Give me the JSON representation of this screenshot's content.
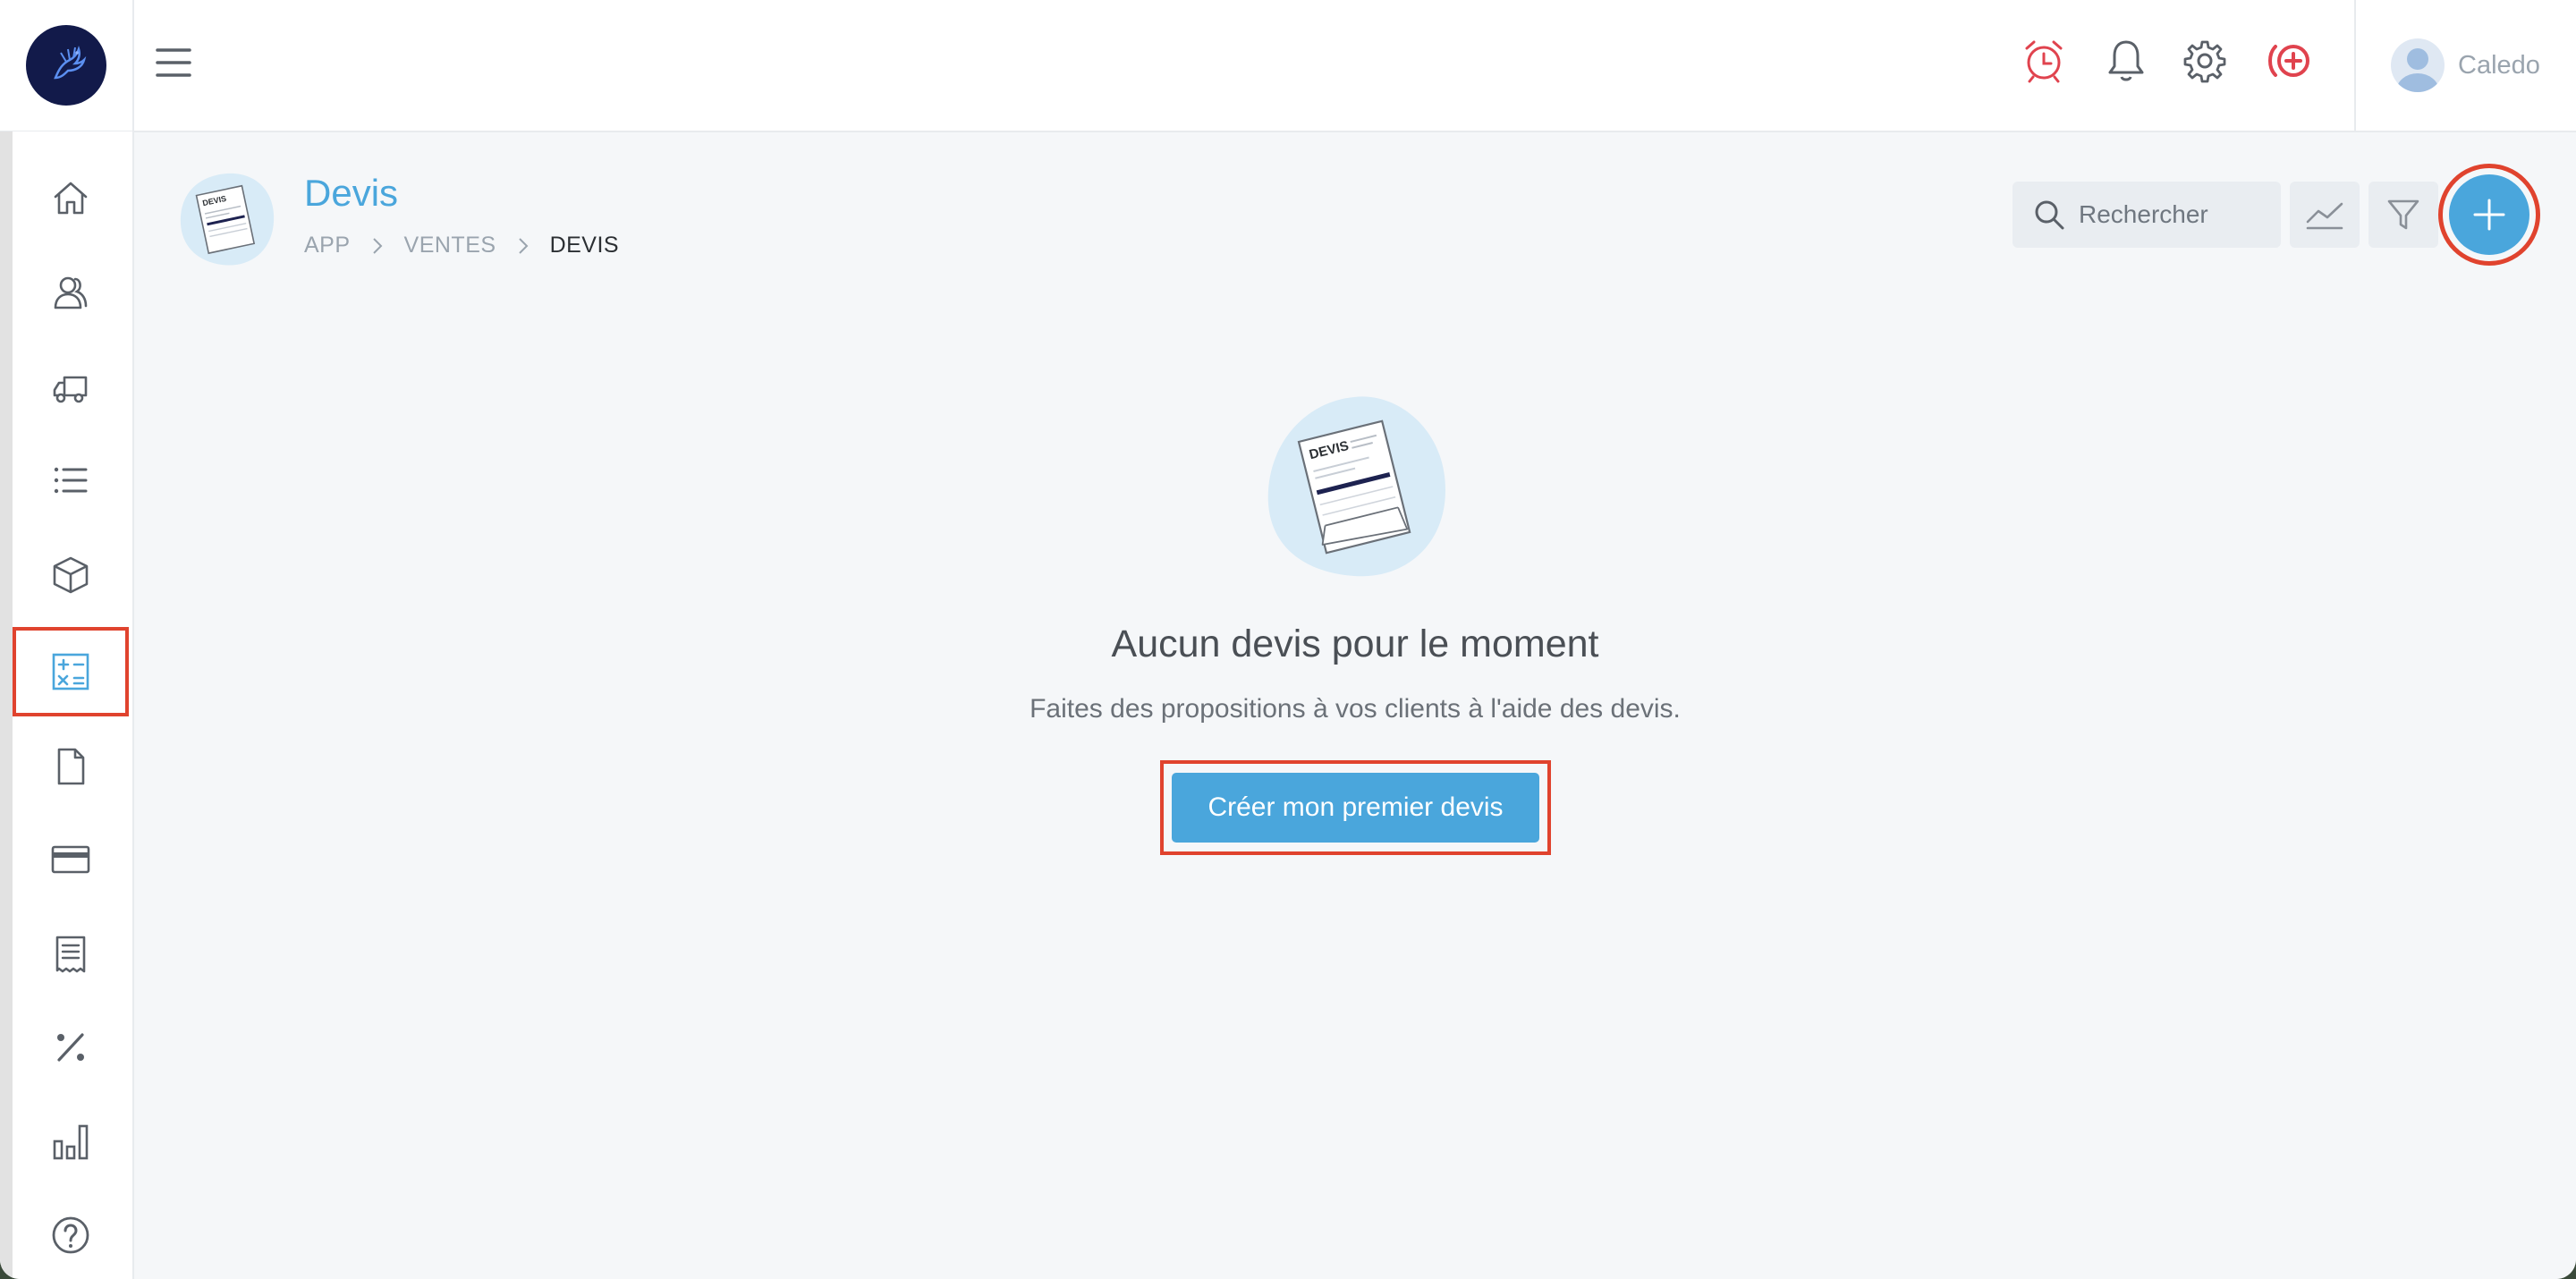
{
  "header": {
    "user_name": "Caledo",
    "icons": [
      "menu-icon",
      "alarm-clock-icon",
      "bell-icon",
      "gear-icon",
      "add-circle-icon"
    ],
    "alert_color": "#e0434e"
  },
  "sidebar": {
    "items": [
      {
        "name": "home",
        "icon": "home-icon"
      },
      {
        "name": "clients",
        "icon": "users-icon"
      },
      {
        "name": "suppliers",
        "icon": "truck-icon"
      },
      {
        "name": "lists",
        "icon": "list-icon"
      },
      {
        "name": "products",
        "icon": "box-icon"
      },
      {
        "name": "quotes",
        "icon": "calculator-icon",
        "active": true
      },
      {
        "name": "documents",
        "icon": "file-icon"
      },
      {
        "name": "payments",
        "icon": "credit-card-icon"
      },
      {
        "name": "receipts",
        "icon": "receipt-icon"
      },
      {
        "name": "taxes",
        "icon": "percent-icon"
      },
      {
        "name": "reports",
        "icon": "bar-chart-icon"
      },
      {
        "name": "help",
        "icon": "help-icon"
      }
    ]
  },
  "page": {
    "title": "Devis",
    "breadcrumb": [
      "APP",
      "VENTES",
      "DEVIS"
    ],
    "illustration_label": "DEVIS"
  },
  "toolbar": {
    "search_placeholder": "Rechercher",
    "icons": [
      "search-icon",
      "trend-chart-icon",
      "filter-icon",
      "plus-icon"
    ]
  },
  "empty_state": {
    "title": "Aucun devis pour le moment",
    "subtitle": "Faites des propositions à vos clients à l'aide des devis.",
    "cta_label": "Créer mon premier devis"
  },
  "colors": {
    "accent": "#4aa6dc",
    "highlight_red": "#e0432e",
    "logo_bg": "#121a4a"
  }
}
